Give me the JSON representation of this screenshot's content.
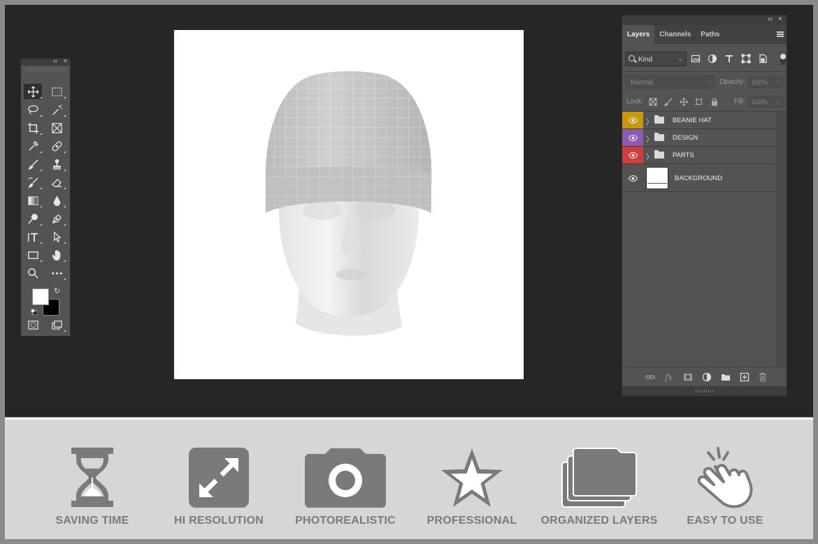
{
  "tools_panel": {
    "collapse_glyph": "‹‹",
    "close_glyph": "×",
    "tools": [
      {
        "id": "move",
        "icon": "move-icon",
        "selected": true
      },
      {
        "id": "marquee",
        "icon": "rectangular-marquee-icon"
      },
      {
        "id": "lasso",
        "icon": "lasso-icon"
      },
      {
        "id": "magic-wand",
        "icon": "magic-wand-icon"
      },
      {
        "id": "crop",
        "icon": "crop-icon"
      },
      {
        "id": "frame",
        "icon": "frame-icon"
      },
      {
        "id": "eyedropper",
        "icon": "eyedropper-icon"
      },
      {
        "id": "healing",
        "icon": "healing-brush-icon"
      },
      {
        "id": "brush",
        "icon": "brush-icon"
      },
      {
        "id": "stamp",
        "icon": "clone-stamp-icon"
      },
      {
        "id": "history-brush",
        "icon": "history-brush-icon"
      },
      {
        "id": "eraser",
        "icon": "eraser-icon"
      },
      {
        "id": "gradient",
        "icon": "gradient-icon"
      },
      {
        "id": "blur",
        "icon": "blur-drop-icon"
      },
      {
        "id": "dodge",
        "icon": "dodge-icon"
      },
      {
        "id": "pen",
        "icon": "pen-icon"
      },
      {
        "id": "type",
        "icon": "type-icon"
      },
      {
        "id": "path-select",
        "icon": "path-selection-icon"
      },
      {
        "id": "rectangle",
        "icon": "rectangle-icon"
      },
      {
        "id": "hand",
        "icon": "hand-icon"
      },
      {
        "id": "zoom",
        "icon": "zoom-icon"
      },
      {
        "id": "more",
        "icon": "more-icon"
      }
    ],
    "foreground_color": "#ffffff",
    "background_color": "#000000"
  },
  "layers_panel": {
    "collapse_glyph": "‹‹",
    "close_glyph": "×",
    "tabs": [
      {
        "label": "Layers",
        "active": true
      },
      {
        "label": "Channels",
        "active": false
      },
      {
        "label": "Paths",
        "active": false
      }
    ],
    "filter_kind": "Kind",
    "blend_mode": "Normal",
    "opacity_label": "Opacity:",
    "opacity_value": "100%",
    "lock_label": "Lock:",
    "fill_label": "Fill:",
    "fill_value": "100%",
    "layers": [
      {
        "name": "BEANIE HAT",
        "type": "group",
        "color": "#c7980e"
      },
      {
        "name": "DESIGN",
        "type": "group",
        "color": "#8e5bb2"
      },
      {
        "name": "PARTS",
        "type": "group",
        "color": "#cf3d3d"
      },
      {
        "name": "BACKGROUND",
        "type": "pixel",
        "color": ""
      }
    ]
  },
  "features": [
    {
      "label": "SAVING TIME",
      "icon": "hourglass-icon"
    },
    {
      "label": "HI RESOLUTION",
      "icon": "expand-arrows-icon"
    },
    {
      "label": "PHOTOREALISTIC",
      "icon": "camera-icon"
    },
    {
      "label": "PROFESSIONAL",
      "icon": "star-icon"
    },
    {
      "label": "ORGANIZED LAYERS",
      "icon": "stacked-folders-icon"
    },
    {
      "label": "EASY TO USE",
      "icon": "tap-hand-icon"
    }
  ],
  "colors": {
    "workspace": "#262626",
    "panel": "#535353",
    "band": "#d6d6d6",
    "feature_gray": "#7a7a7a"
  }
}
